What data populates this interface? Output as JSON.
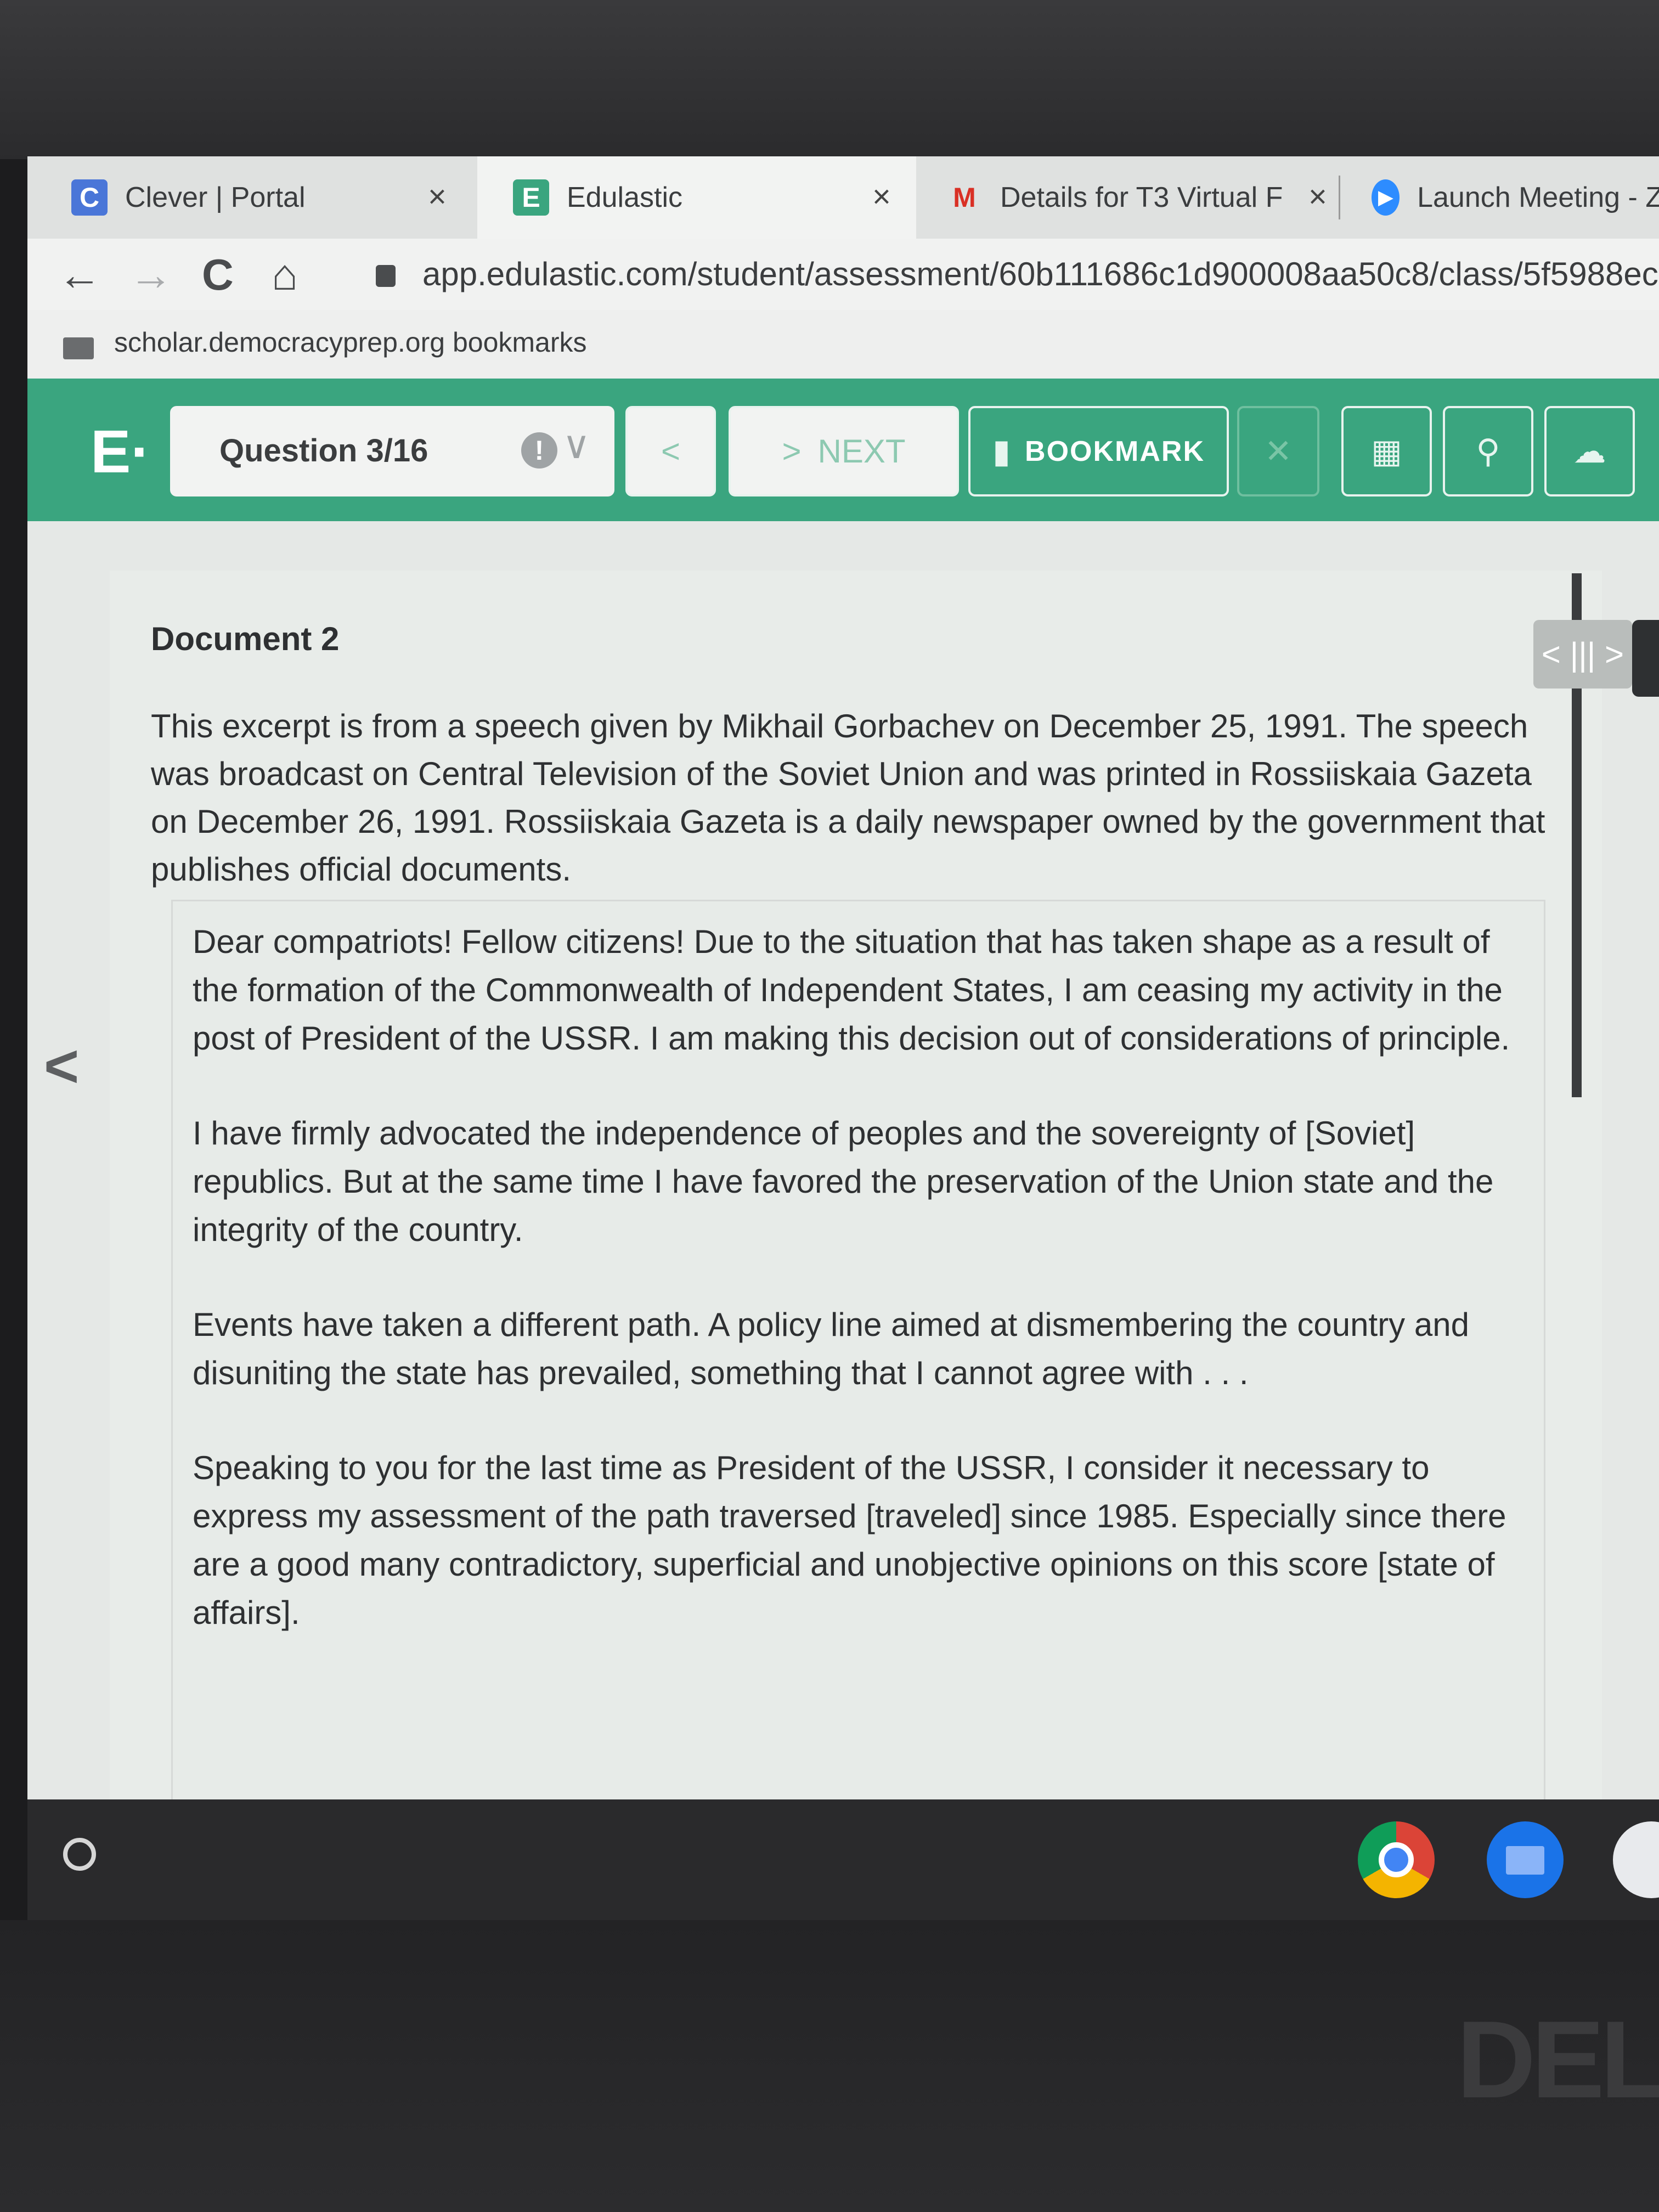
{
  "browser": {
    "tabs": [
      {
        "favicon": "C",
        "favicon_color": "#4a76d8",
        "title": "Clever | Portal",
        "close": "×"
      },
      {
        "favicon": "E",
        "favicon_color": "#3aa57f",
        "title": "Edulastic",
        "close": "×"
      },
      {
        "favicon": "M",
        "favicon_color": "#d93025",
        "title": "Details for T3 Virtual F",
        "close": "×"
      },
      {
        "favicon": "▶",
        "favicon_color": "#2d8cff",
        "title": "Launch Meeting - Zo"
      }
    ],
    "nav": {
      "back_icon": "←",
      "forward_icon": "→",
      "reload_icon": "C",
      "home_icon": "⌂"
    },
    "url": "app.edulastic.com/student/assessment/60b111686c1d900008aa50c8/class/5f5988ec",
    "bookmark_label": "scholar.democracyprep.org bookmarks"
  },
  "header": {
    "logo": "E·",
    "question_label": "Question 3/16",
    "info_icon": "!",
    "chevron_icon": "∨",
    "prev_icon": "<",
    "next_icon": ">",
    "next_label": "NEXT",
    "bookmark_icon": "▮",
    "bookmark_label": "BOOKMARK",
    "close_icon": "✕",
    "calculator_icon": "▦",
    "search_icon": "⚲",
    "upload_icon": "☁",
    "accent_color": "#3aa57f"
  },
  "document": {
    "title": "Document 2",
    "intro": "This excerpt is from a speech given by Mikhail Gorbachev on December 25, 1991. The speech was broadcast on Central Television of the Soviet Union and was printed in Rossiiskaia Gazeta on December 26, 1991. Rossiiskaia Gazeta is a daily newspaper owned by the government that publishes official documents.",
    "quote_paragraphs": [
      "Dear compatriots! Fellow citizens! Due to the situation that has taken shape as a result of the formation of the Commonwealth of Independent States, I am ceasing my activity in the post of President of the USSR. I am making this decision out of considerations of principle.",
      "I have firmly advocated the independence of peoples and the sovereignty of [Soviet] republics. But at the same time I have favored the preservation of the Union state and the integrity of the country.",
      "Events have taken a different path. A policy line aimed at dismembering the country and disuniting the state has prevailed, something that I cannot agree with . . .",
      "Speaking to you for the last time as President of the USSR, I consider it necessary to express my assessment of the path traversed [traveled] since 1985. Especially since there are a good many contradictory, superficial and unobjective opinions on this score [state of affairs]."
    ],
    "left_nav_icon": "<",
    "resizer_label": "< ||| >"
  },
  "shelf": {
    "launcher_icon": "○"
  },
  "brand": "DELL"
}
